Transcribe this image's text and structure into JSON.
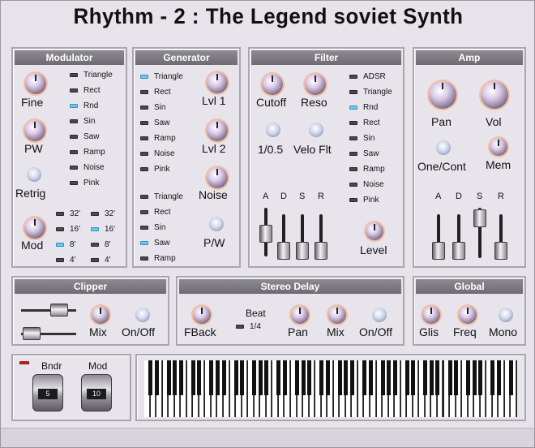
{
  "title": "Rhythm - 2 : The Legend soviet Synth",
  "modulator": {
    "header": "Modulator",
    "knobs": [
      "Fine",
      "PW",
      "Retrig",
      "Mod"
    ],
    "waves": [
      "Triangle",
      "Rect",
      "Rnd",
      "Sin",
      "Saw",
      "Ramp",
      "Noise",
      "Pink"
    ],
    "selected_wave": "Rnd",
    "footages": [
      "32'",
      "16'",
      "8'",
      "4'"
    ]
  },
  "generator": {
    "header": "Generator",
    "waves1": [
      "Triangle",
      "Rect",
      "Sin",
      "Saw",
      "Ramp",
      "Noise",
      "Pink"
    ],
    "waves2": [
      "Triangle",
      "Rect",
      "Sin",
      "Saw",
      "Ramp"
    ],
    "knobs": [
      "Lvl 1",
      "Lvl 2",
      "Noise",
      "P/W"
    ]
  },
  "filter": {
    "header": "Filter",
    "knobs": [
      "Cutoff",
      "Reso",
      "1/0.5",
      "Velo Flt",
      "Level"
    ],
    "modes": [
      "ADSR",
      "Triangle",
      "Rnd",
      "Rect",
      "Sin",
      "Saw",
      "Ramp",
      "Noise",
      "Pink"
    ],
    "selected_mode": "Rnd",
    "adsr": [
      "A",
      "D",
      "S",
      "R"
    ],
    "adsr_levels": [
      0.45,
      0.05,
      0.05,
      0.05
    ]
  },
  "amp": {
    "header": "Amp",
    "knobs": [
      "Pan",
      "Vol",
      "One/Cont",
      "Mem"
    ],
    "adsr": [
      "A",
      "D",
      "S",
      "R"
    ],
    "adsr_levels": [
      0.05,
      0.05,
      0.95,
      0.05
    ]
  },
  "clipper": {
    "header": "Clipper",
    "labels": [
      "Mix",
      "On/Off"
    ]
  },
  "delay": {
    "header": "Stereo Delay",
    "labels": [
      "FBack",
      "Pan",
      "Mix",
      "On/Off"
    ],
    "beat_label": "Beat",
    "beat_value": "1/4"
  },
  "global": {
    "header": "Global",
    "labels": [
      "Glis",
      "Freq",
      "Mono"
    ]
  },
  "wheels": {
    "bender_label": "Bndr",
    "mod_label": "Mod",
    "bender_value": "5",
    "mod_value": "10"
  },
  "colors": {
    "panel_header": "#7d7a82",
    "led_on": "#6cc6f4",
    "led_off": "#4a484d",
    "background": "#e7e3ea"
  }
}
